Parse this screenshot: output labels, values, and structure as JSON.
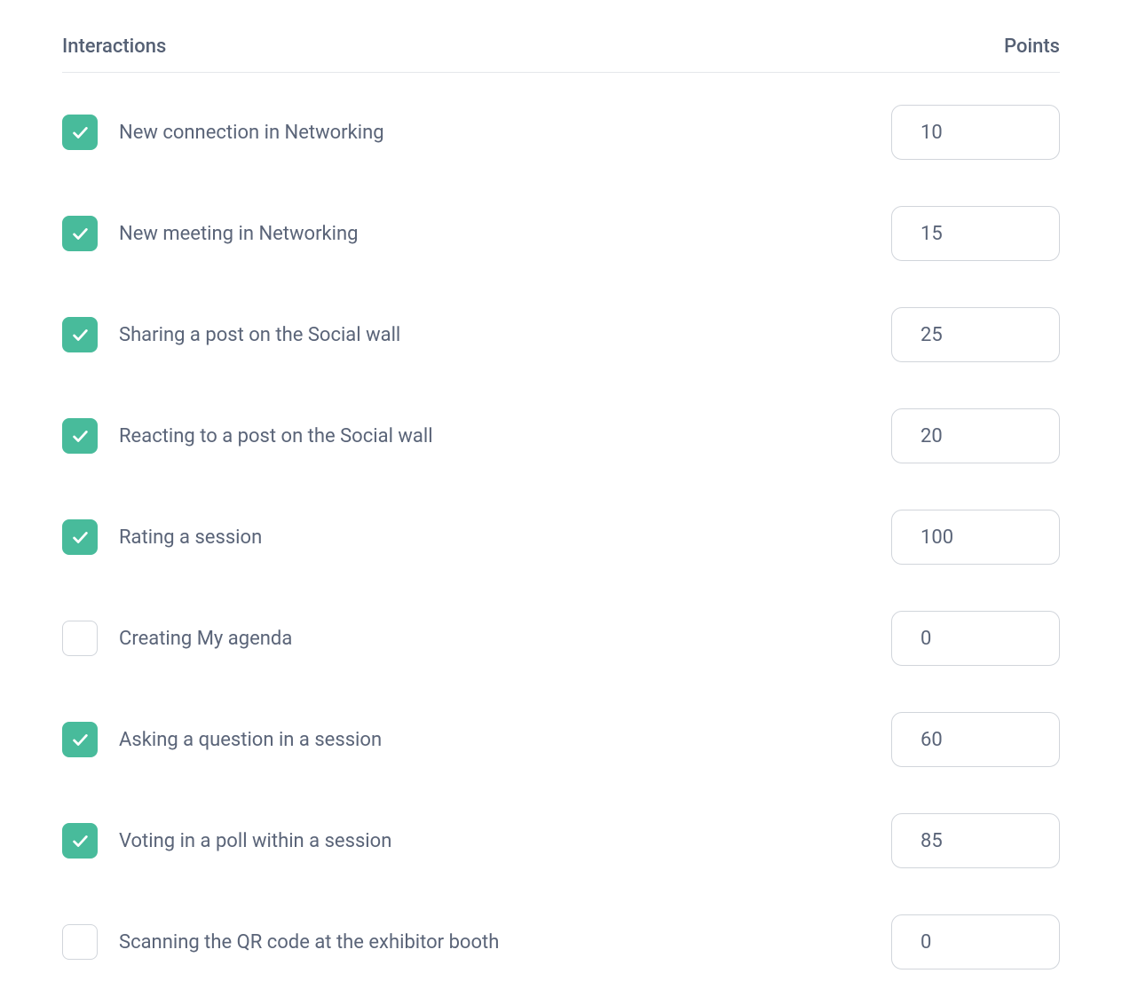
{
  "header": {
    "interactions_label": "Interactions",
    "points_label": "Points"
  },
  "rows": [
    {
      "checked": true,
      "label": "New connection in Networking",
      "points": "10"
    },
    {
      "checked": true,
      "label": "New meeting in Networking",
      "points": "15"
    },
    {
      "checked": true,
      "label": "Sharing a post on the Social wall",
      "points": "25"
    },
    {
      "checked": true,
      "label": "Reacting to a post on the Social wall",
      "points": "20"
    },
    {
      "checked": true,
      "label": "Rating a session",
      "points": "100"
    },
    {
      "checked": false,
      "label": "Creating My agenda",
      "points": "0"
    },
    {
      "checked": true,
      "label": "Asking a question in a session",
      "points": "60"
    },
    {
      "checked": true,
      "label": "Voting in a poll within a session",
      "points": "85"
    },
    {
      "checked": false,
      "label": "Scanning the QR code at the exhibitor booth",
      "points": "0"
    }
  ]
}
